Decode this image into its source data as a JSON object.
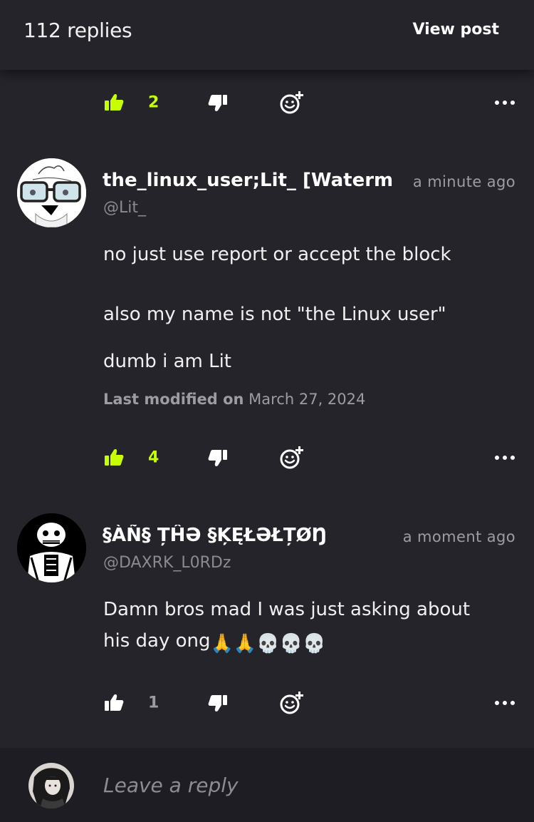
{
  "header": {
    "reply_count": "112 replies",
    "view_post": "View post"
  },
  "colors": {
    "accent": "#c5ff00",
    "background": "#25242b",
    "reply_bar": "#1e1d23",
    "muted": "#9d9ca4"
  },
  "top_actions": {
    "like_count": "2",
    "liked": true
  },
  "comments": [
    {
      "author": "the_linux_user;Lit_  [Waterm",
      "handle": "@Lit_",
      "time": "a minute ago",
      "paragraphs": [
        "no just use report or accept the block",
        "also my name is not \"the Linux user\"",
        "dumb i am Lit"
      ],
      "modified_label": "Last modified on",
      "modified_date": "March 27, 2024",
      "like_count": "4",
      "liked": true,
      "avatar_icon": "glasses-face-icon"
    },
    {
      "author": "§ÀÑ§ ȚĤƏ §ĶĘŁƏŁȚØŊ",
      "handle": "@DAXRK_L0RDz",
      "time": "a moment ago",
      "text_line1": "Damn bros mad I was just asking about",
      "text_line2": "his day ong",
      "emojis": [
        "🙏",
        "🙏",
        "💀",
        "💀",
        "💀"
      ],
      "like_count": "1",
      "liked": false,
      "avatar_icon": "skeleton-icon"
    }
  ],
  "reply_bar": {
    "placeholder": "Leave a reply",
    "avatar_icon": "user-avatar-icon"
  }
}
